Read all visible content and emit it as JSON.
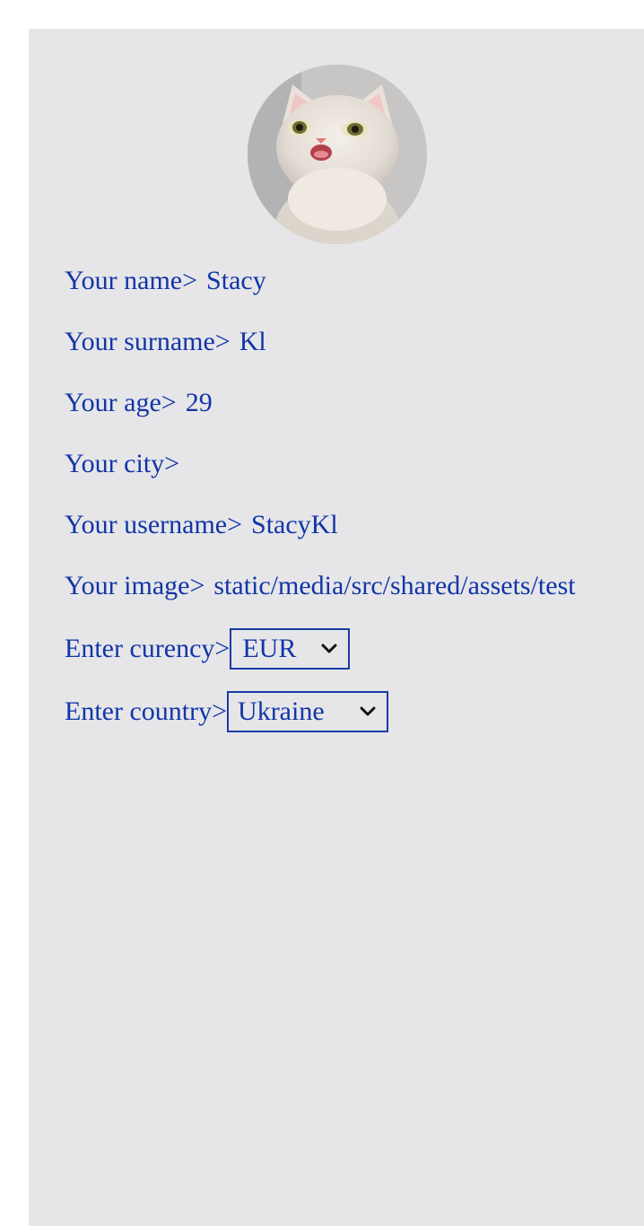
{
  "profile": {
    "avatar_icon": "cat-photo",
    "fields": [
      {
        "label": "Your name>",
        "value": "Stacy"
      },
      {
        "label": "Your surname>",
        "value": "Kl"
      },
      {
        "label": "Your age>",
        "value": "29"
      },
      {
        "label": "Your city>",
        "value": ""
      },
      {
        "label": "Your username>",
        "value": "StacyKl"
      },
      {
        "label": "Your image>",
        "value": "static/media/src/shared/assets/test"
      }
    ],
    "currency": {
      "label": "Enter curency>",
      "selected": "EUR"
    },
    "country": {
      "label": "Enter country>",
      "selected": "Ukraine"
    }
  },
  "colors": {
    "text": "#1235a6",
    "card_background": "#e6e6e9",
    "page_background": "#ffffff"
  }
}
